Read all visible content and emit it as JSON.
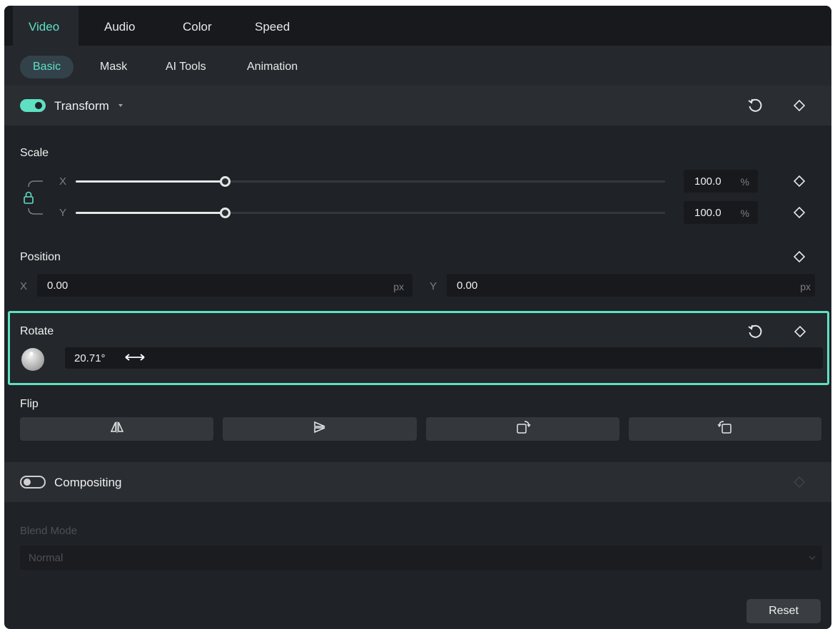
{
  "tabs": [
    "Video",
    "Audio",
    "Color",
    "Speed"
  ],
  "subtabs": [
    "Basic",
    "Mask",
    "AI Tools",
    "Animation"
  ],
  "transform": {
    "label": "Transform",
    "scale": {
      "label": "Scale",
      "x_axis": "X",
      "y_axis": "Y",
      "x_value": "100.0",
      "y_value": "100.0",
      "unit": "%",
      "x_slider_fraction": 0.25,
      "y_slider_fraction": 0.25
    },
    "position": {
      "label": "Position",
      "x_axis": "X",
      "y_axis": "Y",
      "x_value": "0.00",
      "y_value": "0.00",
      "unit": "px"
    },
    "rotate": {
      "label": "Rotate",
      "value": "20.71°"
    },
    "flip": {
      "label": "Flip"
    }
  },
  "compositing": {
    "label": "Compositing",
    "blend_mode_label": "Blend Mode",
    "blend_mode_value": "Normal"
  },
  "footer": {
    "reset_label": "Reset"
  },
  "colors": {
    "accent": "#5ee0c3",
    "panel_bg": "#1f2226"
  }
}
